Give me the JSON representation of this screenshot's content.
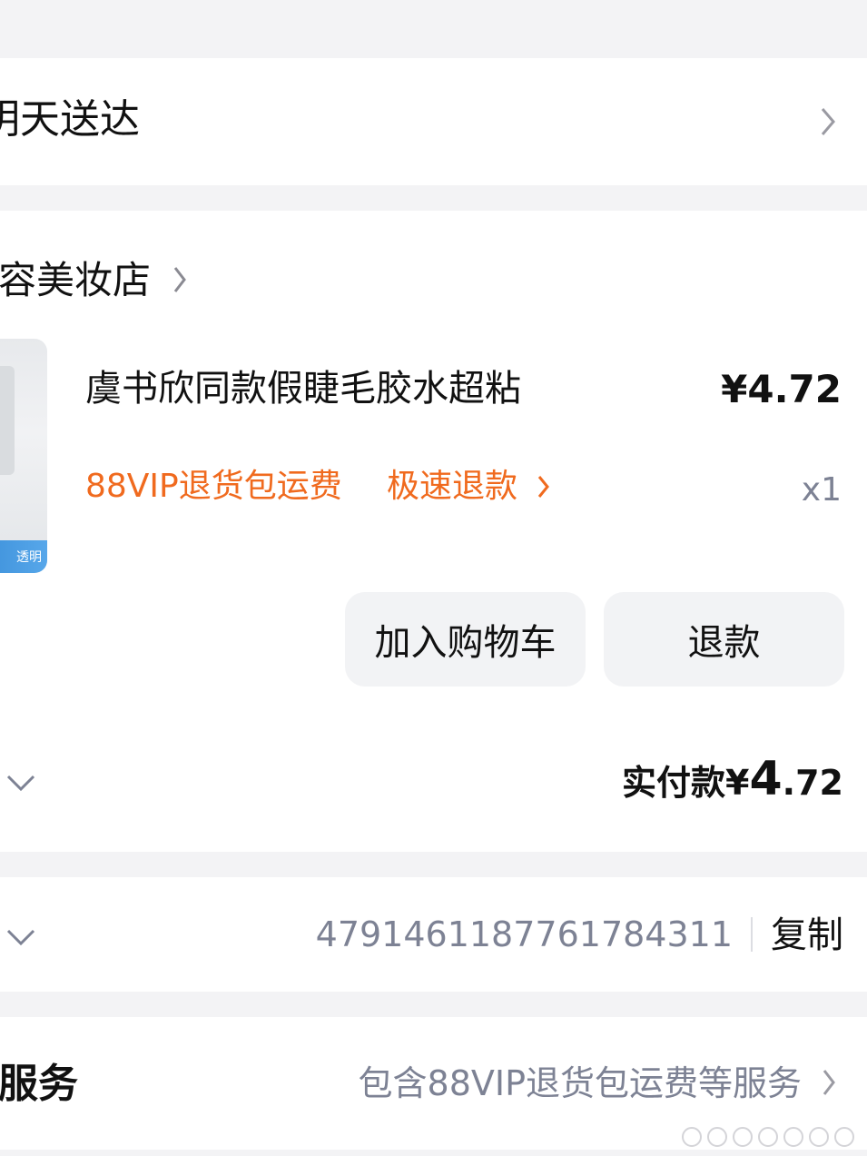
{
  "delivery": {
    "text": "明天送达"
  },
  "shop": {
    "name": "容美妆店"
  },
  "product": {
    "title": "虞书欣同款假睫毛胶水超粘",
    "price": "¥4.72",
    "qty": "x1",
    "tag_vip": "88VIP退货包运费",
    "tag_refund": "极速退款",
    "thumb_text": "透明"
  },
  "actions": {
    "add_cart": "加入购物车",
    "refund": "退款"
  },
  "payment": {
    "label": "实付款",
    "currency": "¥",
    "int": "4",
    "dec": ".72"
  },
  "order": {
    "number": "4791461187761784311",
    "copy": "复制"
  },
  "services": {
    "label": "服务",
    "summary": "包含88VIP退货包运费等服务"
  },
  "colors": {
    "orange": "#f06a1e",
    "grey_text": "#7d8294",
    "page_bg": "#f3f3f5"
  },
  "icons": [
    "chevron-right-icon",
    "chevron-down-icon"
  ]
}
